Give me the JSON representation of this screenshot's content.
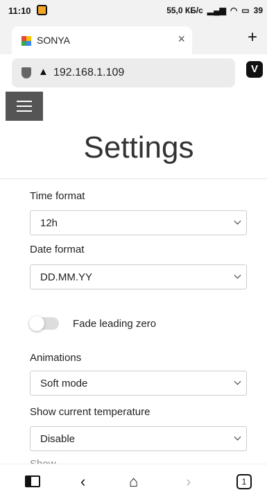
{
  "status_bar": {
    "time": "11:10",
    "network": "55,0 КБ/с",
    "battery": "39"
  },
  "browser": {
    "tab_title": "SONYA",
    "close_symbol": "×",
    "new_tab_symbol": "+",
    "url": "192.168.1.109",
    "brand_letter": "V"
  },
  "page": {
    "title": "Settings",
    "time_format": {
      "label": "Time format",
      "value": "12h"
    },
    "date_format": {
      "label": "Date format",
      "value": "DD.MM.YY"
    },
    "fade_leading_zero": {
      "label": "Fade leading zero",
      "enabled": false
    },
    "animations": {
      "label": "Animations",
      "value": "Soft mode"
    },
    "show_current_temperature": {
      "label": "Show current temperature",
      "value": "Disable"
    },
    "next_section_partial": "Show ..."
  },
  "bottom_nav": {
    "tab_count": "1"
  },
  "colors": {
    "menu_button": "#555555",
    "toggle_off": "#dddddd",
    "status_bar": "#f2f2f2"
  }
}
